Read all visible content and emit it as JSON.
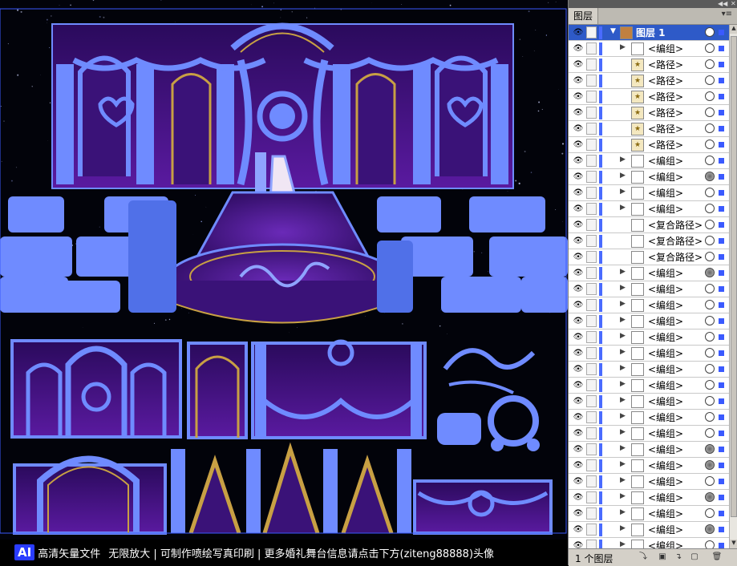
{
  "canvas": {
    "footer_logo": "AI",
    "footer_logo_text": "高清矢量文件",
    "footer_slogan": "无限放大 | 可制作喷绘写真印刷 | 更多婚礼舞台信息请点击下方(ziteng88888)头像"
  },
  "panel": {
    "title_tab": "图层",
    "layer_count": "1 个图层",
    "layer": {
      "label": "图层 1"
    },
    "items": [
      {
        "label": "<编组>",
        "target": "empty",
        "thumb": "",
        "has_arrow": true
      },
      {
        "label": "<路径>",
        "target": "empty",
        "thumb": "star-icon",
        "has_arrow": false
      },
      {
        "label": "<路径>",
        "target": "empty",
        "thumb": "star-icon",
        "has_arrow": false
      },
      {
        "label": "<路径>",
        "target": "empty",
        "thumb": "star-icon",
        "has_arrow": false
      },
      {
        "label": "<路径>",
        "target": "empty",
        "thumb": "star-icon",
        "has_arrow": false
      },
      {
        "label": "<路径>",
        "target": "empty",
        "thumb": "star-icon",
        "has_arrow": false
      },
      {
        "label": "<路径>",
        "target": "empty",
        "thumb": "star-icon",
        "has_arrow": false
      },
      {
        "label": "<编组>",
        "target": "empty",
        "thumb": "",
        "has_arrow": true
      },
      {
        "label": "<编组>",
        "target": "filled",
        "thumb": "",
        "has_arrow": true
      },
      {
        "label": "<编组>",
        "target": "empty",
        "thumb": "",
        "has_arrow": true
      },
      {
        "label": "<编组>",
        "target": "empty",
        "thumb": "",
        "has_arrow": true
      },
      {
        "label": "<复合路径>",
        "target": "empty",
        "thumb": "",
        "has_arrow": false
      },
      {
        "label": "<复合路径>",
        "target": "empty",
        "thumb": "",
        "has_arrow": false
      },
      {
        "label": "<复合路径>",
        "target": "empty",
        "thumb": "",
        "has_arrow": false
      },
      {
        "label": "<编组>",
        "target": "filled",
        "thumb": "",
        "has_arrow": true
      },
      {
        "label": "<编组>",
        "target": "empty",
        "thumb": "",
        "has_arrow": true
      },
      {
        "label": "<编组>",
        "target": "empty",
        "thumb": "",
        "has_arrow": true
      },
      {
        "label": "<编组>",
        "target": "empty",
        "thumb": "",
        "has_arrow": true
      },
      {
        "label": "<编组>",
        "target": "empty",
        "thumb": "",
        "has_arrow": true
      },
      {
        "label": "<编组>",
        "target": "empty",
        "thumb": "",
        "has_arrow": true
      },
      {
        "label": "<编组>",
        "target": "empty",
        "thumb": "",
        "has_arrow": true
      },
      {
        "label": "<编组>",
        "target": "empty",
        "thumb": "",
        "has_arrow": true
      },
      {
        "label": "<编组>",
        "target": "empty",
        "thumb": "",
        "has_arrow": true
      },
      {
        "label": "<编组>",
        "target": "empty",
        "thumb": "",
        "has_arrow": true
      },
      {
        "label": "<编组>",
        "target": "empty",
        "thumb": "",
        "has_arrow": true
      },
      {
        "label": "<编组>",
        "target": "filled",
        "thumb": "",
        "has_arrow": true
      },
      {
        "label": "<编组>",
        "target": "filled",
        "thumb": "",
        "has_arrow": true
      },
      {
        "label": "<编组>",
        "target": "empty",
        "thumb": "",
        "has_arrow": true
      },
      {
        "label": "<编组>",
        "target": "filled",
        "thumb": "",
        "has_arrow": true
      },
      {
        "label": "<编组>",
        "target": "empty",
        "thumb": "",
        "has_arrow": true
      },
      {
        "label": "<编组>",
        "target": "filled",
        "thumb": "",
        "has_arrow": true
      },
      {
        "label": "<编组>",
        "target": "empty",
        "thumb": "",
        "has_arrow": true
      }
    ]
  },
  "colors": {
    "artwork_blue": "#5f7dff",
    "stage_purple": "#3c1170",
    "gold": "#c8a044",
    "selection_blue": "#3a5aff"
  }
}
